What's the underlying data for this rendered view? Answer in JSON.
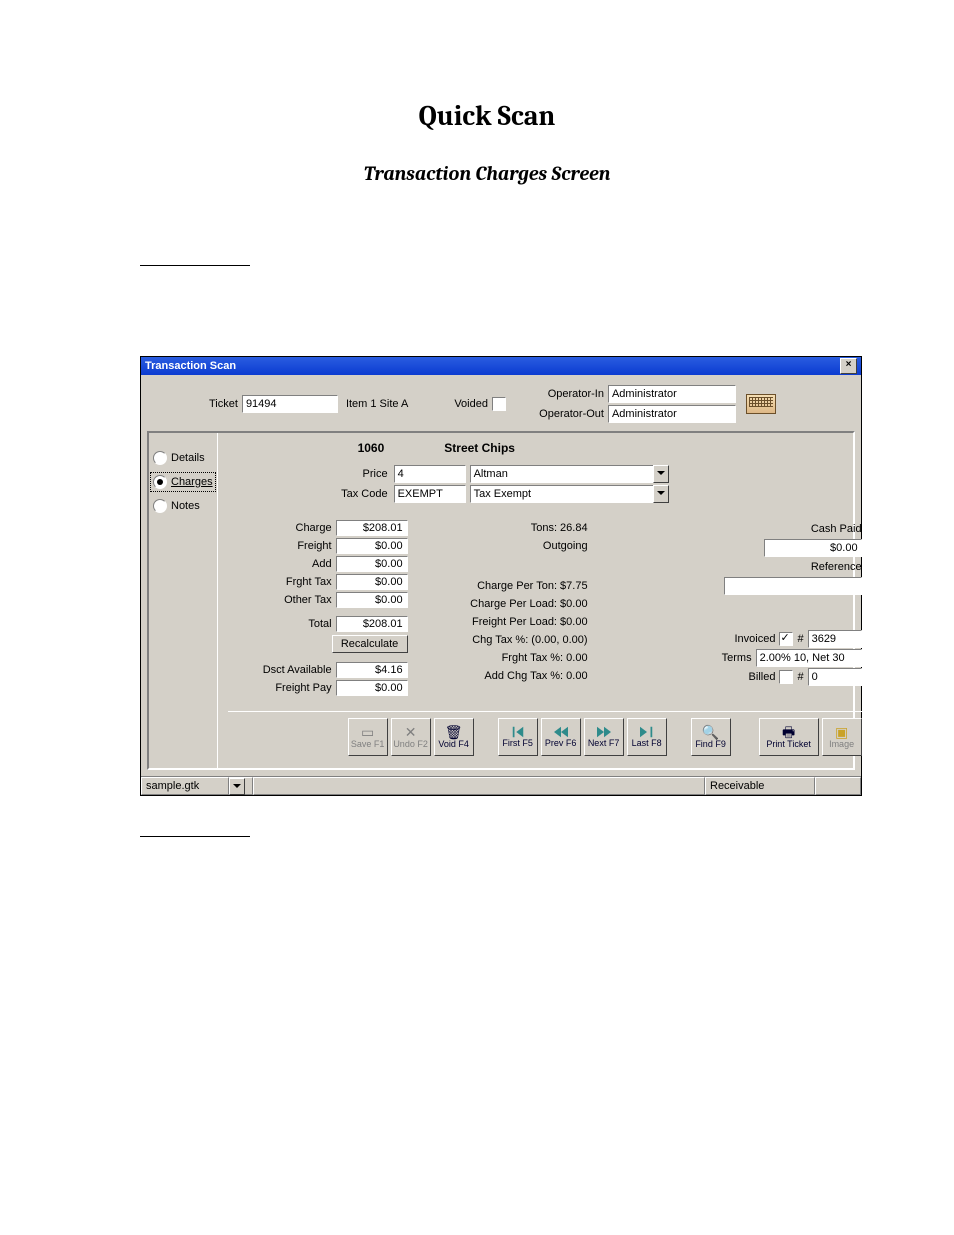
{
  "doc": {
    "title": "Quick Scan",
    "subtitle": "Transaction Charges Screen"
  },
  "window": {
    "title": "Transaction Scan",
    "close": "×"
  },
  "top": {
    "ticket_label": "Ticket",
    "ticket_value": "91494",
    "item_label": "Item 1  Site A",
    "voided_label": "Voided",
    "voided_checked": false,
    "operator_in_label": "Operator-In",
    "operator_in_value": "Administrator",
    "operator_out_label": "Operator-Out",
    "operator_out_value": "Administrator"
  },
  "tabs": {
    "details": "Details",
    "charges": "Charges",
    "notes": "Notes"
  },
  "header": {
    "code": "1060",
    "desc": "Street  Chips"
  },
  "price": {
    "price_label": "Price",
    "price_code": "4",
    "price_desc": "Altman",
    "tax_label": "Tax Code",
    "tax_code": "EXEMPT",
    "tax_desc": "Tax Exempt"
  },
  "charges": {
    "charge_label": "Charge",
    "charge_value": "$208.01",
    "freight_label": "Freight",
    "freight_value": "$0.00",
    "add_label": "Add",
    "add_value": "$0.00",
    "frght_tax_label": "Frght Tax",
    "frght_tax_value": "$0.00",
    "other_tax_label": "Other Tax",
    "other_tax_value": "$0.00",
    "total_label": "Total",
    "total_value": "$208.01",
    "recalculate": "Recalculate",
    "dsct_label": "Dsct Available",
    "dsct_value": "$4.16",
    "fpay_label": "Freight Pay",
    "fpay_value": "$0.00"
  },
  "info": {
    "tons": "Tons: 26.84",
    "direction": "Outgoing",
    "cpt": "Charge Per Ton:  $7.75",
    "cpl": "Charge Per Load:  $0.00",
    "fpl": "Freight Per Load:  $0.00",
    "chg_tax": "Chg Tax %:  (0.00, 0.00)",
    "frght_tax": "Frght Tax %:  0.00",
    "add_chg_tax": "Add Chg Tax %:  0.00"
  },
  "cash": {
    "cash_paid_label": "Cash Paid",
    "cash_paid_value": "$0.00",
    "reference_label": "Reference",
    "reference_value": "",
    "invoiced_label": "Invoiced",
    "invoiced_checked": true,
    "invoiced_num_label": "#",
    "invoiced_num": "3629",
    "terms_label": "Terms",
    "terms_value": "2.00% 10, Net 30",
    "billed_label": "Billed",
    "billed_checked": false,
    "billed_num_label": "#",
    "billed_num": "0"
  },
  "toolbar": {
    "save": "Save F1",
    "undo": "Undo F2",
    "void": "Void F4",
    "first": "First F5",
    "prev": "Prev F6",
    "next": "Next F7",
    "last": "Last F8",
    "find": "Find F9",
    "print": "Print Ticket",
    "image": "Image"
  },
  "status": {
    "file": "sample.gtk",
    "receivable": "Receivable"
  },
  "colors": {
    "titlebar": "#0b3bd1",
    "panel": "#d4d0c8"
  }
}
